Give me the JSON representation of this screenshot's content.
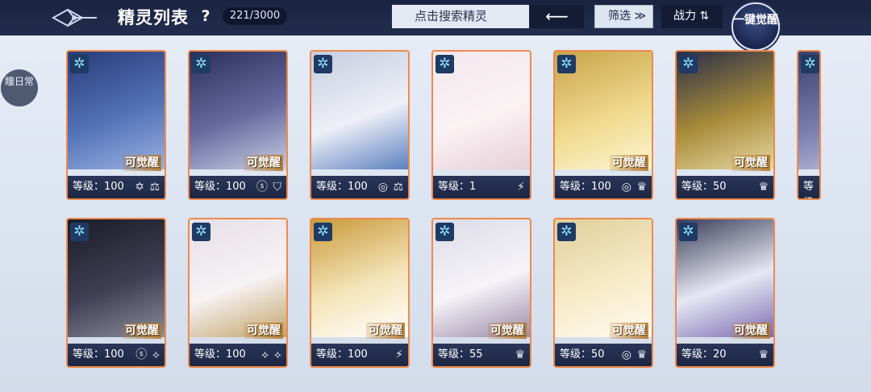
{
  "header": {
    "title": "精灵列表",
    "help": "?",
    "count": "221/3000",
    "search_placeholder": "点击搜索精灵",
    "search_button": "⟵",
    "filter_label": "筛选 ≫",
    "sort_label": "战力 ⇅",
    "awaken_label": "一键觉醒"
  },
  "side": {
    "tab_label": "瞳日常"
  },
  "awaken_text": "可觉醒",
  "element_glyph": "✲",
  "rows": [
    [
      {
        "level": "等级：100",
        "awaken": true,
        "icons": "✡ ⚖",
        "art": [
          "#2a3c78",
          "#5472b8",
          "#9ab2e0"
        ]
      },
      {
        "level": "等级：100",
        "awaken": true,
        "icons": "ⓢ ⛉",
        "art": [
          "#2c2f5a",
          "#686aa0",
          "#c8cde0"
        ]
      },
      {
        "level": "等级：100",
        "awaken": false,
        "icons": "◎ ⚖",
        "art": [
          "#c6cde0",
          "#eef0f7",
          "#5c80c0"
        ]
      },
      {
        "level": "等级：1",
        "awaken": false,
        "icons": "⚡",
        "art": [
          "#f2e8ee",
          "#fbf2f4",
          "#e6cfd8"
        ]
      },
      {
        "level": "等级：100",
        "awaken": true,
        "icons": "◎ ♛",
        "art": [
          "#c8a44c",
          "#efd98c",
          "#fff5d2"
        ]
      },
      {
        "level": "等级：50",
        "awaken": true,
        "icons": "♛",
        "art": [
          "#2a2e48",
          "#a88c3a",
          "#e6d7a2"
        ]
      },
      {
        "level": "等级：",
        "awaken": false,
        "icons": "",
        "art": [
          "#3b3f6a",
          "#7a7fb0",
          "#c9cce4"
        ]
      }
    ],
    [
      {
        "level": "等级：100",
        "awaken": true,
        "icons": "ⓢ ⟡",
        "art": [
          "#1b1c28",
          "#3e3f52",
          "#8a8c9c"
        ]
      },
      {
        "level": "等级：100",
        "awaken": true,
        "icons": "⟡ ⟡",
        "art": [
          "#e6e0e8",
          "#f7f2f4",
          "#c2a46a"
        ]
      },
      {
        "level": "等级：100",
        "awaken": true,
        "icons": "⚡",
        "art": [
          "#c89a3a",
          "#f4e4b8",
          "#ffffff"
        ]
      },
      {
        "level": "等级：55",
        "awaken": true,
        "icons": "♛",
        "art": [
          "#dcdce8",
          "#f6f4f8",
          "#9a8aa8"
        ]
      },
      {
        "level": "等级：50",
        "awaken": true,
        "icons": "◎ ♛",
        "art": [
          "#e0cf9a",
          "#f7ebc8",
          "#fffaf0"
        ]
      },
      {
        "level": "等级：20",
        "awaken": true,
        "icons": "♛",
        "art": [
          "#3a3d58",
          "#e6e8f4",
          "#7a6ab0"
        ]
      }
    ]
  ]
}
